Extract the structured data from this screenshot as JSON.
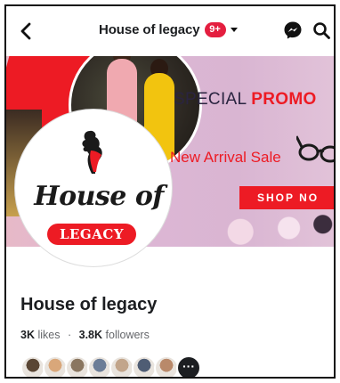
{
  "header": {
    "title": "House of legacy",
    "notification_badge": "9+",
    "icons": [
      "back-arrow-icon",
      "chevron-down-icon",
      "messenger-icon",
      "search-icon"
    ]
  },
  "cover": {
    "promo_word1": "SPECIAL",
    "promo_word2": "PROMO",
    "arrival_text": "New Arrival Sale",
    "shop_button": "SHOP NO"
  },
  "profile": {
    "logo_script": "House of",
    "logo_tag": "LEGACY"
  },
  "page": {
    "name": "House of legacy",
    "likes_count": "3K",
    "likes_label": "likes",
    "separator": "·",
    "followers_count": "3.8K",
    "followers_label": "followers"
  },
  "followers_avatars": {
    "colors": [
      "#5a4634",
      "#d9a77a",
      "#8a7660",
      "#6c7d97",
      "#c2a58b",
      "#4f5d74",
      "#b9896a"
    ],
    "more_label": "···"
  },
  "colors": {
    "brand_red": "#ed1b24",
    "badge_red": "#e41e3f",
    "text_primary": "#1c1e21",
    "text_secondary": "#65676b"
  }
}
